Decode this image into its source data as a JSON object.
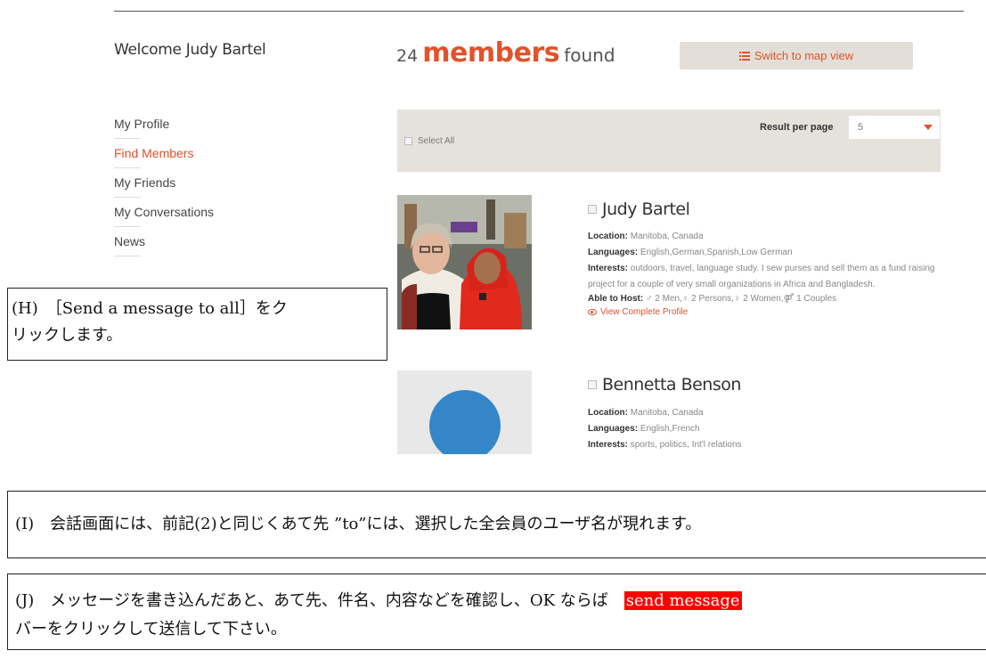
{
  "header": {
    "welcome": "Welcome Judy Bartel",
    "count_number": "24",
    "count_word": "members",
    "count_suffix": "found",
    "map_button_label": "Switch to map view"
  },
  "sidebar": {
    "items": [
      {
        "label": "My Profile",
        "active": false
      },
      {
        "label": "Find Members",
        "active": true
      },
      {
        "label": "My Friends",
        "active": false
      },
      {
        "label": "My Conversations",
        "active": false
      },
      {
        "label": "News",
        "active": false
      }
    ]
  },
  "filter": {
    "select_all_label": "Select All",
    "results_per_page_label": "Result per page",
    "results_per_page_value": "5"
  },
  "members": [
    {
      "name": "Judy Bartel",
      "location_label": "Location:",
      "location": "Manitoba, Canada",
      "languages_label": "Languages:",
      "languages": "English,German,Spanish,Low German",
      "interests_label": "Interests:",
      "interests": "outdoors, travel, language study. I sew purses and sell them as a fund raising project for a couple of very small organizations in Africa and Bangladesh.",
      "host_label": "Able to Host:",
      "host_men": "2 Men,",
      "host_persons": "2 Persons,",
      "host_women": "2 Women,",
      "host_couples": "1 Couples",
      "view_profile": "View Complete Profile"
    },
    {
      "name": "Bennetta Benson",
      "location_label": "Location:",
      "location": "Manitoba, Canada",
      "languages_label": "Languages:",
      "languages": "English,French",
      "interests_label": "Interests:",
      "interests": "sports, politics, Int'l relations"
    }
  ],
  "notes": {
    "h_line1": "(H)　［Send a message to all］をク",
    "h_line2": "リックします。",
    "i_text": "(I)　会話画面には、前記(2)と同じくあて先 ”to”には、選択した全会員のユーザ名が現れます。",
    "j_text": "(J)　メッセージを書き込んだあと、あて先、件名、内容などを確認し、OK ならば　",
    "j_highlight": "send message",
    "j_line2": "バーをクリックして送信して下さい。"
  },
  "colors": {
    "accent": "#e2522b",
    "highlight": "#ff0000",
    "filter_bg": "#e5e2dc"
  }
}
